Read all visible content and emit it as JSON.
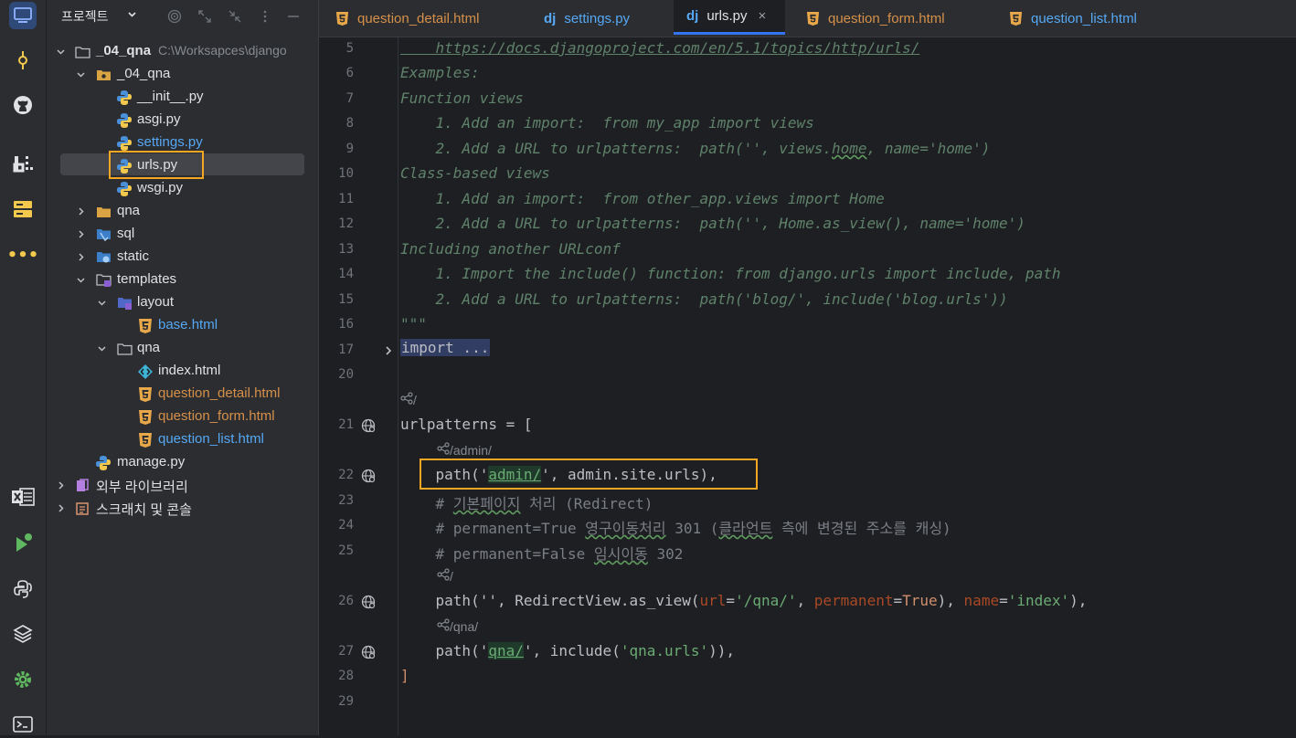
{
  "project": {
    "title": "프로젝트",
    "tree": [
      {
        "label": "_04_qna",
        "sub": "C:\\Worksapces\\django",
        "bold": true
      },
      {
        "label": "_04_qna"
      },
      {
        "label": "__init__.py"
      },
      {
        "label": "asgi.py"
      },
      {
        "label": "settings.py"
      },
      {
        "label": "urls.py"
      },
      {
        "label": "wsgi.py"
      },
      {
        "label": "qna"
      },
      {
        "label": "sql"
      },
      {
        "label": "static"
      },
      {
        "label": "templates"
      },
      {
        "label": "layout"
      },
      {
        "label": "base.html"
      },
      {
        "label": "qna"
      },
      {
        "label": "index.html"
      },
      {
        "label": "question_detail.html"
      },
      {
        "label": "question_form.html"
      },
      {
        "label": "question_list.html"
      },
      {
        "label": "manage.py"
      },
      {
        "label": "외부 라이브러리"
      },
      {
        "label": "스크래치 및 콘솔"
      }
    ]
  },
  "tabs": [
    {
      "label": "question_detail.html"
    },
    {
      "label": "settings.py"
    },
    {
      "label": "urls.py",
      "close": "×"
    },
    {
      "label": "question_form.html"
    },
    {
      "label": "question_list.html"
    }
  ],
  "colors": {
    "accent_box": "#f5a623",
    "html_icon": "#e8a84a",
    "python_blue": "#4a90d9",
    "python_yellow": "#f2c94c",
    "link_blue": "#56a8f5",
    "modified_orange": "#d6904a"
  },
  "editor": {
    "lines": [
      {
        "n": "5",
        "t": "    https://docs.djangoproject.com/en/5.1/topics/http/urls/"
      },
      {
        "n": "6",
        "t": "Examples:"
      },
      {
        "n": "7",
        "t": "Function views"
      },
      {
        "n": "8",
        "t": "    1. Add an import:  from my_app import views"
      },
      {
        "n": "9a",
        "t": "    2. Add a URL to urlpatterns:  path('', views."
      },
      {
        "n": "9b",
        "t": "home"
      },
      {
        "n": "9c",
        "t": ", name='home')"
      },
      {
        "n": "10",
        "t": "Class-based views"
      },
      {
        "n": "11",
        "t": "    1. Add an import:  from other_app.views import Home"
      },
      {
        "n": "12",
        "t": "    2. Add a URL to urlpatterns:  path('', Home.as_view(), name='home')"
      },
      {
        "n": "13",
        "t": "Including another URLconf"
      },
      {
        "n": "14",
        "t": "    1. Import the include() function: from django.urls import include, path"
      },
      {
        "n": "15",
        "t": "    2. Add a URL to urlpatterns:  path('blog/', include('blog.urls'))"
      },
      {
        "n": "16",
        "t": "\"\"\""
      }
    ],
    "line_numbers": [
      "5",
      "6",
      "7",
      "8",
      "9",
      "10",
      "11",
      "12",
      "13",
      "14",
      "15",
      "16",
      "17",
      "20",
      "21",
      "22",
      "23",
      "24",
      "25",
      "26",
      "27",
      "28",
      "29"
    ],
    "import_fold": "import ...",
    "urlpatterns_head": "urlpatterns = [",
    "hint_root": "/",
    "hint_admin": "/admin/",
    "hint_root2": "/",
    "hint_qna": "/qna/",
    "l22": {
      "a": "    path('",
      "b": "admin/",
      "c": "', admin.site.urls),"
    },
    "l23": {
      "a": "    # ",
      "b": "기본페이지",
      "c": " 처리 (Redirect)"
    },
    "l24": {
      "a": "    # permanent=True ",
      "b": "영구이동처리",
      "c": " 301 (",
      "d": "클라언트",
      "e": " 측에 변경된 주소를 캐싱)"
    },
    "l25": {
      "a": "    # permanent=False ",
      "b": "임시이동",
      "c": " 302"
    },
    "l26": {
      "a": "    path('', RedirectView.as_view(",
      "b": "url",
      "c": "=",
      "d": "'/qna/'",
      "e": ", ",
      "f": "permanent",
      "g": "=",
      "h": "True",
      "i": "), ",
      "j": "name",
      "k": "=",
      "l": "'index'",
      "m": "),"
    },
    "l27": {
      "a": "    path('",
      "b": "qna/",
      "c": "', include(",
      "d": "'qna.urls'",
      "e": ")),"
    },
    "l28": "]"
  }
}
